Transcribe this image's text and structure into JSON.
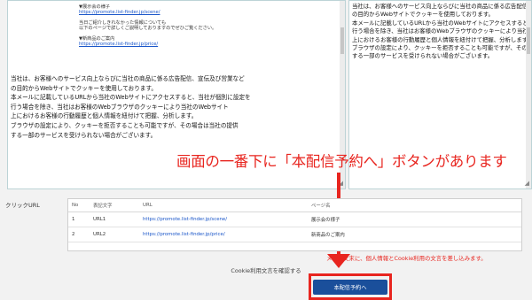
{
  "template": {
    "lines": [
      {
        "text": "▼展示会の様子",
        "link": false
      },
      {
        "text": "https://promote.list-finder.jp/scene/",
        "link": true
      },
      {
        "text": "",
        "gap": true
      },
      {
        "text": "当日ご紹介しきれなかった情報についても",
        "link": false
      },
      {
        "text": "以下のページで詳しくご説明しておりますのでぜひご覧ください。",
        "link": false
      },
      {
        "text": "",
        "gap": true
      },
      {
        "text": "▼新商品のご案内",
        "link": false
      },
      {
        "text": "https://promote.list-finder.jp/price/",
        "link": true
      }
    ]
  },
  "body_text": "当社は、お客様へのサービス向上ならびに当社の商品に係る広告配信、宣伝及び営業など\nの目的からWebサイトでクッキーを使用しております。\n本メールに記載しているURLから当社のWebサイトにアクセスすると、当社が個別に設定を\n行う場合を除き、当社はお客様のWebブラウザのクッキーにより当社のWebサイト\n上におけるお客様の行動履歴と個人情報を紐付けて把握、分析します。\nブラウザの設定により、クッキーを拒否することも可能ですが、その場合は当社の提供\nする一部のサービスを受けられない場合がございます。",
  "preview_text": "当社は、お客様へのサービス向上ならびに当社の商品に係る広告配信、宣伝及\nの目的からWebサイトでクッキーを使用しております。\n本メールに記載しているURLから当社のWebサイトにアクセスすると、当社が個別\n行う場合を除き、当社はお客様のWebブラウザのクッキーにより当社のWebサイト\n上におけるお客様の行動履歴と個人情報を紐付けて把握、分析します。\nブラウザの設定により、クッキーを拒否することも可能ですが、その場合は当社\nする一部のサービスを受けられない場合がございます。",
  "annotation": "画面の一番下に「本配信予約へ」ボタンがあります",
  "click_url": {
    "label": "クリックURL",
    "headers": [
      "No",
      "表記文字",
      "URL",
      "ページ名"
    ],
    "rows": [
      [
        "1",
        "URL1",
        "https://promote.list-finder.jp/scene/",
        "展示会の様子"
      ],
      [
        "2",
        "URL2",
        "https://promote.list-finder.jp/price/",
        "新商品のご案内"
      ]
    ]
  },
  "note": "メール文末に、個人情報とCookie利用の文言を差し込みます。",
  "cookie_confirm": "Cookie利用文言を確認する",
  "send_button": "本配信予約へ",
  "colors": {
    "accent_red": "#e8251f",
    "button_blue": "#1a4f9b",
    "link_blue": "#1a56c9"
  }
}
